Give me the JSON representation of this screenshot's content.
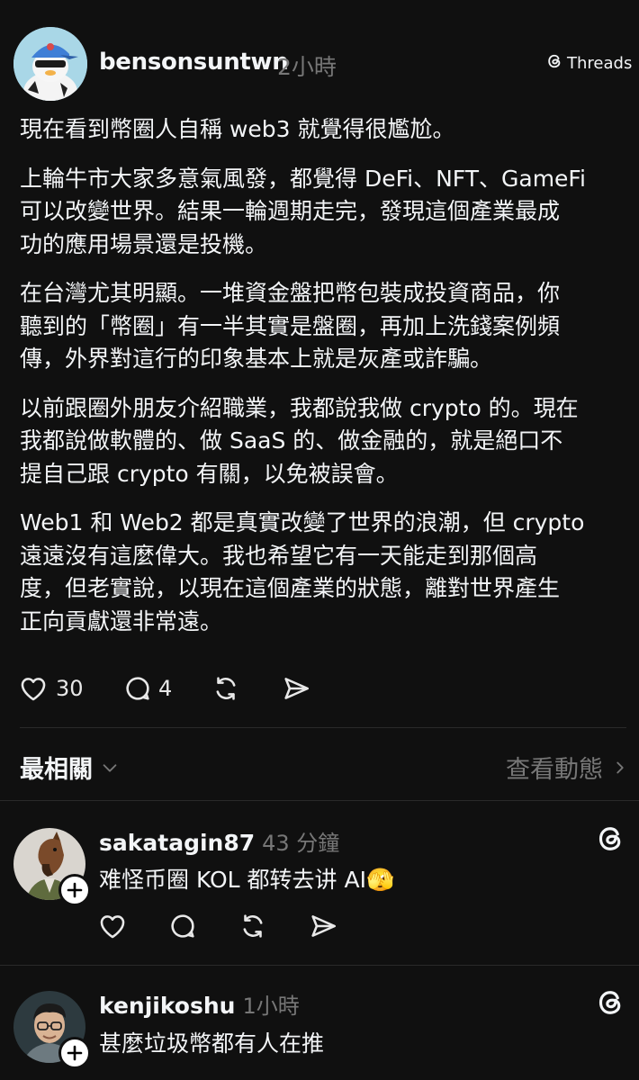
{
  "post": {
    "username": "bensonsuntwn",
    "time": "2小時",
    "platform_label": "Threads",
    "paragraphs": [
      [
        "現在看到幣圈人自稱 web3 就覺得很尷尬。"
      ],
      [
        "上輪牛市大家多意氣風發，都覺得 DeFi、NFT、GameFi",
        "可以改變世界。結果一輪週期走完，發現這個產業最成",
        "功的應用場景還是投機。"
      ],
      [
        "在台灣尤其明顯。一堆資金盤把幣包裝成投資商品，你",
        "聽到的「幣圈」有一半其實是盤圈，再加上洗錢案例頻",
        "傳，外界對這行的印象基本上就是灰產或詐騙。"
      ],
      [
        "以前跟圈外朋友介紹職業，我都說我做 crypto 的。現在",
        "我都說做軟體的、做 SaaS 的、做金融的，就是絕口不",
        "提自己跟 crypto 有關，以免被誤會。"
      ],
      [
        "Web1 和 Web2 都是真實改變了世界的浪潮，但 crypto",
        "遠遠沒有這麼偉大。我也希望它有一天能走到那個高",
        "度，但老實說，以現在這個產業的狀態，離對世界產生",
        "正向貢獻還非常遠。"
      ]
    ],
    "likes": "30",
    "comments": "4"
  },
  "replies_header": {
    "sort_label": "最相關",
    "activity_label": "查看動態"
  },
  "replies": [
    {
      "username": "sakatagin87",
      "time": "43 分鐘",
      "text": "难怪币圈 KOL 都转去讲 AI",
      "emoji": "🫣"
    },
    {
      "username": "kenjikoshu",
      "time": "1小時",
      "text": "甚麼垃圾幣都有人在推"
    }
  ],
  "icons": [
    "threads-logo",
    "heart",
    "comment",
    "repost",
    "share",
    "chevron-down",
    "chevron-right",
    "plus"
  ],
  "colors": {
    "background": "#101010",
    "text": "#f3f5f7",
    "muted": "#777777",
    "divider": "#2a2a2a"
  }
}
